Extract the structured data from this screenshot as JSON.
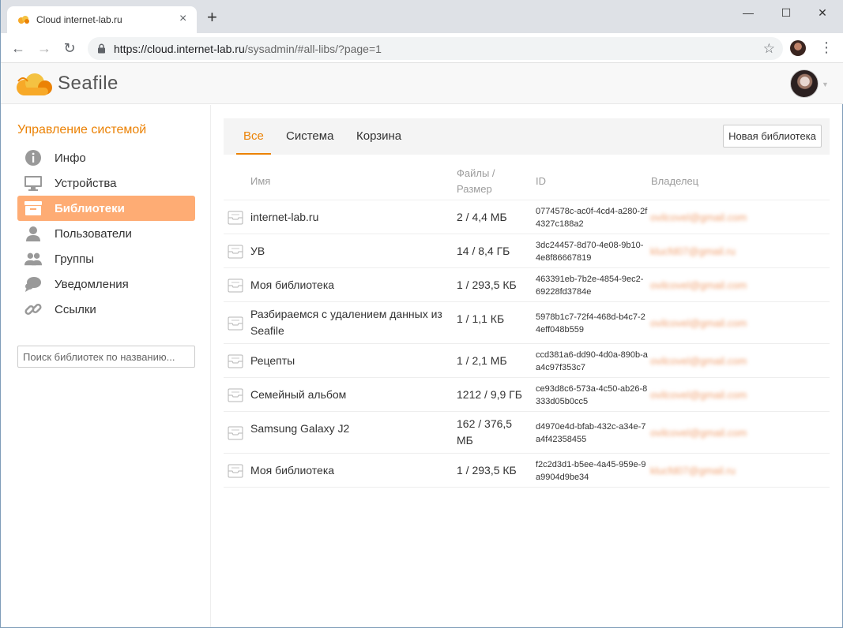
{
  "browser": {
    "tab_title": "Cloud internet-lab.ru",
    "url_host": "https://cloud.internet-lab.ru",
    "url_path": "/sysadmin/#all-libs/?page=1",
    "new_tab": "+",
    "minimize": "—",
    "maximize": "☐",
    "close": "✕"
  },
  "app": {
    "logo_sea": "Sea",
    "logo_file": "file"
  },
  "sidebar": {
    "title": "Управление системой",
    "items": [
      {
        "label": "Инфо",
        "icon": "info-icon"
      },
      {
        "label": "Устройства",
        "icon": "monitor-icon"
      },
      {
        "label": "Библиотеки",
        "icon": "library-icon",
        "active": true
      },
      {
        "label": "Пользователи",
        "icon": "user-icon"
      },
      {
        "label": "Группы",
        "icon": "group-icon"
      },
      {
        "label": "Уведомления",
        "icon": "notification-icon"
      },
      {
        "label": "Ссылки",
        "icon": "link-icon"
      }
    ],
    "search_placeholder": "Поиск библиотек по названию..."
  },
  "main": {
    "tabs": [
      "Все",
      "Система",
      "Корзина"
    ],
    "active_tab": "Все",
    "new_library_button": "Новая библиотека",
    "columns": {
      "name": "Имя",
      "files_size_1": "Файлы /",
      "files_size_2": "Размер",
      "id": "ID",
      "owner": "Владелец"
    },
    "rows": [
      {
        "name": "internet-lab.ru",
        "size": "2 / 4,4 МБ",
        "id": "0774578c-ac0f-4cd4-a280-2f4327c188a2",
        "owner": "ovilcovel@gmail.com"
      },
      {
        "name": "УВ",
        "size": "14 / 8,4 ГБ",
        "id": "3dc24457-8d70-4e08-9b10-4e8f86667819",
        "owner": "klucfd07@gmail.ru"
      },
      {
        "name": "Моя библиотека",
        "size": "1 / 293,5 КБ",
        "id": "463391eb-7b2e-4854-9ec2-69228fd3784e",
        "owner": "ovilcovel@gmail.com"
      },
      {
        "name": "Разбираемся с удалением данных из Seafile",
        "size": "1 / 1,1 КБ",
        "id": "5978b1c7-72f4-468d-b4c7-24eff048b559",
        "owner": "ovilcovel@gmail.com"
      },
      {
        "name": "Рецепты",
        "size": "1 / 2,1 МБ",
        "id": "ccd381a6-dd90-4d0a-890b-aa4c97f353c7",
        "owner": "ovilcovel@gmail.com"
      },
      {
        "name": "Семейный альбом",
        "size": "1212 / 9,9 ГБ",
        "id": "ce93d8c6-573a-4c50-ab26-8333d05b0cc5",
        "owner": "ovilcovel@gmail.com"
      },
      {
        "name": "Samsung Galaxy J2",
        "size": "162 / 376,5 МБ",
        "id": "d4970e4d-bfab-432c-a34e-7a4f42358455",
        "owner": "ovilcovel@gmail.com"
      },
      {
        "name": "Моя библиотека",
        "size": "1 / 293,5 КБ",
        "id": "f2c2d3d1-b5ee-4a45-959e-9a9904d9be34",
        "owner": "klucfd07@gmail.ru"
      }
    ]
  },
  "colors": {
    "accent": "#eb8205",
    "active_bg": "#feac74"
  }
}
